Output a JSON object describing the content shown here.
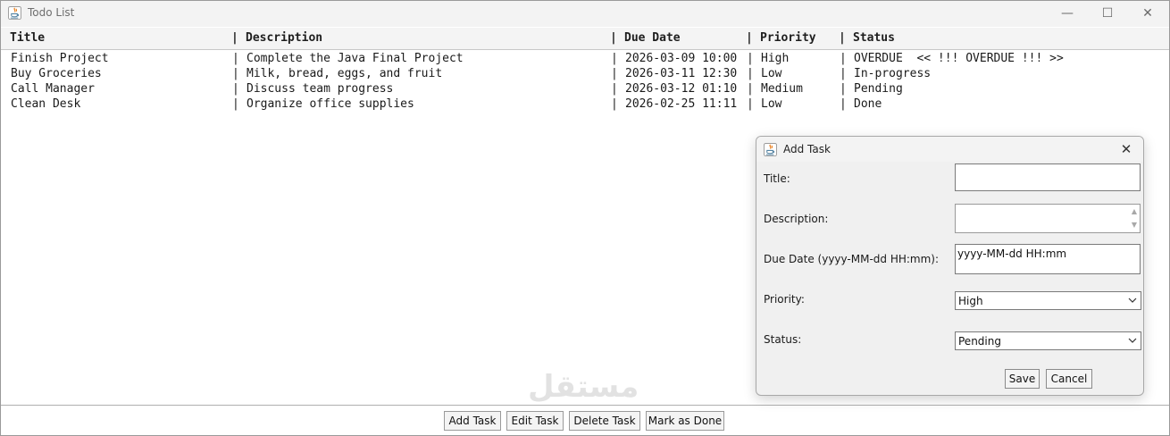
{
  "window": {
    "title": "Todo List",
    "icon": "java-cup-icon",
    "controls": {
      "minimize": "—",
      "maximize": "☐",
      "close": "✕"
    }
  },
  "table": {
    "separator": "|",
    "columns": [
      "Title",
      "Description",
      "Due Date",
      "Priority",
      "Status"
    ],
    "rows": [
      {
        "title": "Finish Project",
        "description": "Complete the Java Final Project",
        "due": "2026-03-09 10:00",
        "priority": "High",
        "status": "OVERDUE  << !!! OVERDUE !!! >>"
      },
      {
        "title": "Buy Groceries",
        "description": "Milk, bread, eggs, and fruit",
        "due": "2026-03-11 12:30",
        "priority": "Low",
        "status": "In-progress"
      },
      {
        "title": "Call Manager",
        "description": "Discuss team progress",
        "due": "2026-03-12 01:10",
        "priority": "Medium",
        "status": "Pending"
      },
      {
        "title": "Clean Desk",
        "description": "Organize office supplies",
        "due": "2026-02-25 11:11",
        "priority": "Low",
        "status": "Done"
      }
    ]
  },
  "buttons": {
    "add": "Add Task",
    "edit": "Edit Task",
    "delete": "Delete Task",
    "done": "Mark as Done"
  },
  "watermark": "مستقل",
  "dialog": {
    "title": "Add Task",
    "close": "✕",
    "labels": {
      "title": "Title:",
      "description": "Description:",
      "due": "Due Date (yyyy-MM-dd HH:mm):",
      "priority": "Priority:",
      "status": "Status:"
    },
    "values": {
      "title": "",
      "description": "",
      "due": "yyyy-MM-dd HH:mm",
      "priority": "High",
      "status": "Pending"
    },
    "buttons": {
      "save": "Save",
      "cancel": "Cancel"
    }
  },
  "colors": {
    "background": "#ffffff",
    "dialog_background": "#f0f0f0",
    "titlebar": "#f3f3f3",
    "java_icon_orange": "#e76f00",
    "java_icon_blue": "#5382a1"
  }
}
